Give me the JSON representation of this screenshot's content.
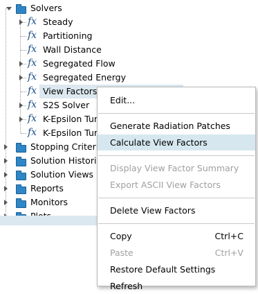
{
  "tree": {
    "root": {
      "label": "Solvers",
      "icon": "folder-icon"
    },
    "solvers": [
      {
        "label": "Steady",
        "icon": "fx-icon",
        "expandable": true
      },
      {
        "label": "Partitioning",
        "icon": "fx-icon",
        "expandable": false
      },
      {
        "label": "Wall Distance",
        "icon": "fx-icon",
        "expandable": false
      },
      {
        "label": "Segregated Flow",
        "icon": "fx-icon",
        "expandable": true
      },
      {
        "label": "Segregated Energy",
        "icon": "fx-icon",
        "expandable": true
      },
      {
        "label": "View Factors Calculator",
        "icon": "fx-icon",
        "expandable": false,
        "selected": true
      },
      {
        "label": "S2S Solver",
        "icon": "fx-icon",
        "expandable": true
      },
      {
        "label": "K-Epsilon Turbulence",
        "icon": "fx-icon",
        "expandable": true
      },
      {
        "label": "K-Epsilon Turbulent Viscosity",
        "icon": "fx-icon",
        "expandable": false
      }
    ],
    "folders": [
      {
        "label": "Stopping Criteria",
        "icon": "folder-icon"
      },
      {
        "label": "Solution Histories",
        "icon": "folder-icon"
      },
      {
        "label": "Solution Views",
        "icon": "folder-icon"
      },
      {
        "label": "Reports",
        "icon": "folder-icon"
      },
      {
        "label": "Monitors",
        "icon": "folder-icon"
      },
      {
        "label": "Plots",
        "icon": "folder-icon"
      }
    ]
  },
  "context_menu": {
    "items": [
      {
        "label": "Edit...",
        "shortcut": "",
        "enabled": true,
        "highlighted": false
      },
      {
        "separator": true
      },
      {
        "label": "Generate Radiation Patches",
        "shortcut": "",
        "enabled": true,
        "highlighted": false
      },
      {
        "label": "Calculate View Factors",
        "shortcut": "",
        "enabled": true,
        "highlighted": true
      },
      {
        "separator": true
      },
      {
        "label": "Display View Factor Summary",
        "shortcut": "",
        "enabled": false,
        "highlighted": false
      },
      {
        "label": "Export ASCII View Factors",
        "shortcut": "",
        "enabled": false,
        "highlighted": false
      },
      {
        "separator": true
      },
      {
        "label": "Delete View Factors",
        "shortcut": "",
        "enabled": true,
        "highlighted": false
      },
      {
        "separator": true
      },
      {
        "label": "Copy",
        "shortcut": "Ctrl+C",
        "enabled": true,
        "highlighted": false
      },
      {
        "label": "Paste",
        "shortcut": "Ctrl+V",
        "enabled": false,
        "highlighted": false
      },
      {
        "label": "Restore Default Settings",
        "shortcut": "",
        "enabled": true,
        "highlighted": false
      },
      {
        "label": "Refresh",
        "shortcut": "",
        "enabled": true,
        "highlighted": false
      }
    ]
  },
  "colors": {
    "folder": "#2f86c6",
    "fx_icon": "#1b4f86",
    "selection": "#dce8f0",
    "menu_highlight": "#d6e7ef",
    "disabled_text": "#a0a0a0"
  }
}
